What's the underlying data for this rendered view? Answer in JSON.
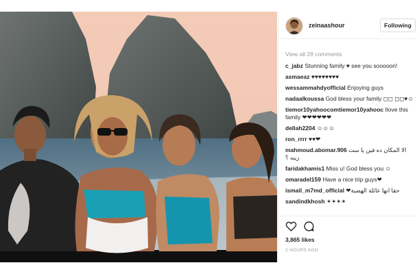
{
  "post": {
    "header": {
      "username": "zeinaashour",
      "follow_label": "Following",
      "avatar_icon": "profile-avatar"
    },
    "comments_link": "View all 29 comments",
    "comments": [
      {
        "user": "c_jabz",
        "text": "Stunning family ♥ see you sooooon!"
      },
      {
        "user": "asmaeaz",
        "text": "♥♥♥♥♥♥♥♥"
      },
      {
        "user": "wessammahdyofficial",
        "text": "Enjoying guys"
      },
      {
        "user": "nadaalkoussa",
        "text": "God bless your family ◻◻ ◻◻♥☺"
      },
      {
        "user": "tiemor10yahoocomtiemor10yahooc",
        "text": "Ilove this family ❤❤❤❤❤❤"
      },
      {
        "user": "dellah2204",
        "text": "☺☺☺"
      },
      {
        "user": "ron_rrrr",
        "text": "♥♥❤"
      },
      {
        "user": "mahmoud.abomar.906",
        "text": "الا المكان ده فين يا ست زينه ؟",
        "rtl": true
      },
      {
        "user": "faridakhamis1",
        "text": "Miss u! God bless you ☺"
      },
      {
        "user": "omaradel159",
        "text": "Have a nice trip guys❤"
      },
      {
        "user": "ismail_m7md_official",
        "text": "حقا انها عائلة الهضبة❤",
        "rtl": true
      },
      {
        "user": "sandindkhosh",
        "text": "✶✶✶✶"
      }
    ],
    "actions": {
      "like_icon": "heart-icon",
      "comment_icon": "comment-icon"
    },
    "likes": "3,865 likes",
    "timestamp": "2 HOURS AGO",
    "colors": {
      "text": "#262626",
      "muted": "#999999",
      "border": "#dbdbdb"
    }
  }
}
